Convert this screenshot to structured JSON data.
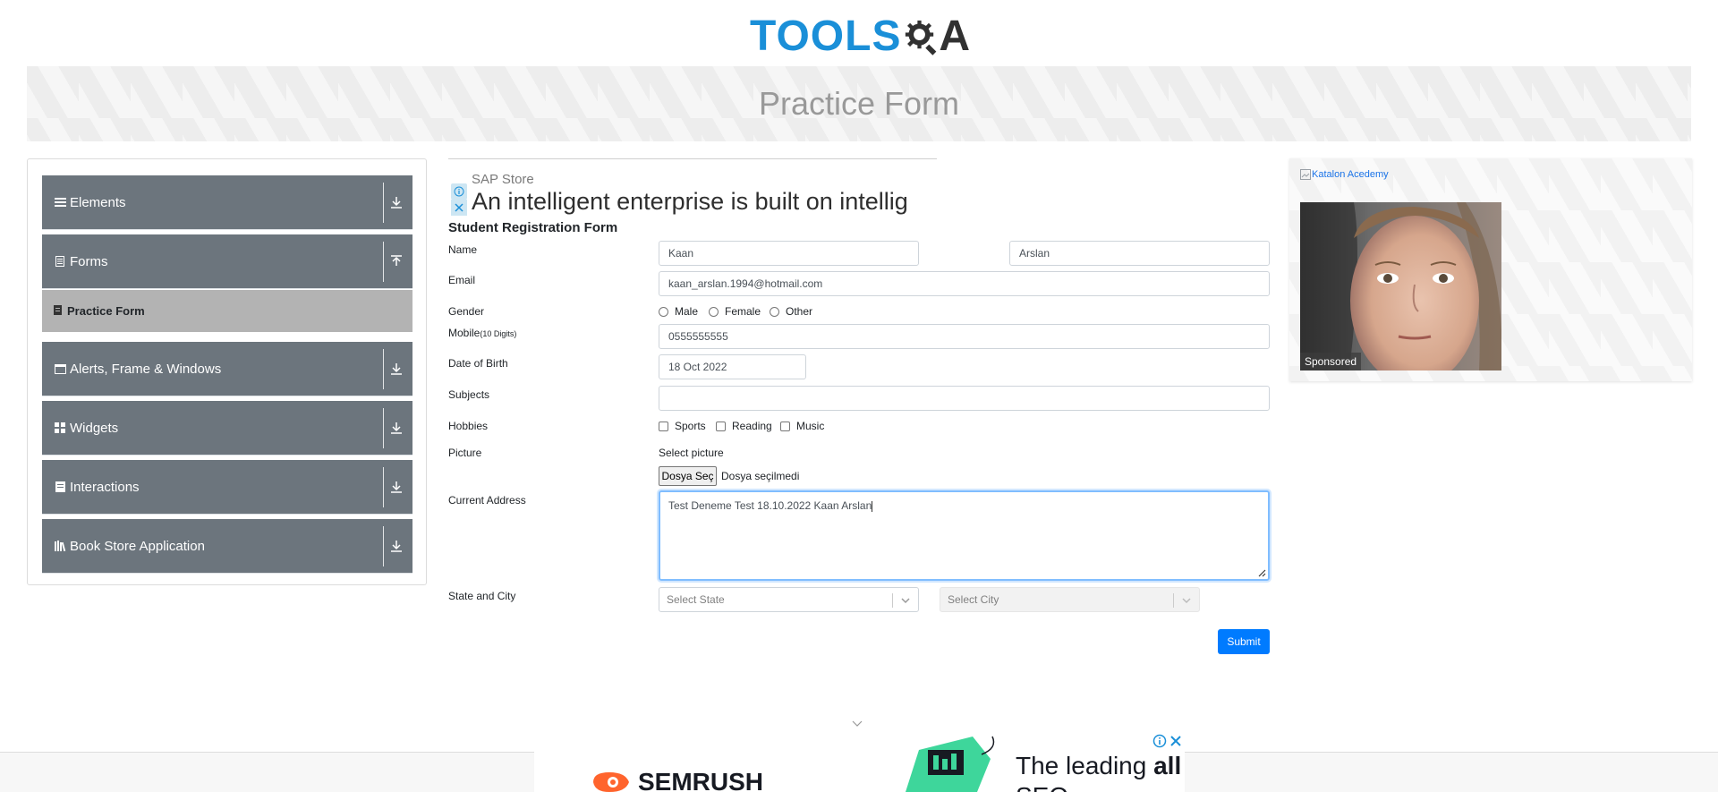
{
  "header": {
    "logo_left": "TOOLS",
    "logo_right": "A"
  },
  "banner": {
    "title": "Practice Form"
  },
  "sidebar": {
    "groups": [
      {
        "label": "Elements",
        "icon": "menu-lines-icon",
        "arrow": "download-icon"
      },
      {
        "label": "Forms",
        "icon": "file-icon",
        "arrow": "upload-icon"
      },
      {
        "label": "Alerts, Frame & Windows",
        "icon": "window-icon",
        "arrow": "download-icon"
      },
      {
        "label": "Widgets",
        "icon": "grid-icon",
        "arrow": "download-icon"
      },
      {
        "label": "Interactions",
        "icon": "list-box-icon",
        "arrow": "download-icon"
      },
      {
        "label": "Book Store Application",
        "icon": "books-icon",
        "arrow": "download-icon"
      }
    ],
    "sub_item": {
      "label": "Practice Form",
      "icon": "file-icon"
    }
  },
  "ad_top": {
    "store": "SAP Store",
    "headline": "An intelligent enterprise is built on intellig"
  },
  "form": {
    "title": "Student Registration Form",
    "labels": {
      "name": "Name",
      "email": "Email",
      "gender": "Gender",
      "mobile": "Mobile",
      "mobile_hint": "(10 Digits)",
      "dob": "Date of Birth",
      "subjects": "Subjects",
      "hobbies": "Hobbies",
      "picture": "Picture",
      "address": "Current Address",
      "state_city": "State and City"
    },
    "first_name": "Kaan",
    "last_name": "Arslan",
    "email": "kaan_arslan.1994@hotmail.com",
    "gender_options": [
      "Male",
      "Female",
      "Other"
    ],
    "mobile": "0555555555",
    "dob": "18 Oct 2022",
    "subjects": "",
    "hobbies": [
      "Sports",
      "Reading",
      "Music"
    ],
    "picture_label": "Select picture",
    "file_button": "Dosya Seç",
    "file_status": "Dosya seçilmedi",
    "address": "Test Deneme Test 18.10.2022 Kaan Arslan",
    "state_placeholder": "Select State",
    "city_placeholder": "Select City",
    "submit": "Submit"
  },
  "right_ad": {
    "link_text": "Katalon Acedemy",
    "sponsored": "Sponsored"
  },
  "ad_bottom": {
    "brand": "SEMRUSH",
    "line1_prefix": "The leading ",
    "line1_bold": "all",
    "line2": "SEO ..."
  },
  "colors": {
    "accent": "#007bff",
    "sidebar": "#6c757d",
    "sidebar_active": "#b3b3b3",
    "logo_blue": "#1a8fd8"
  }
}
